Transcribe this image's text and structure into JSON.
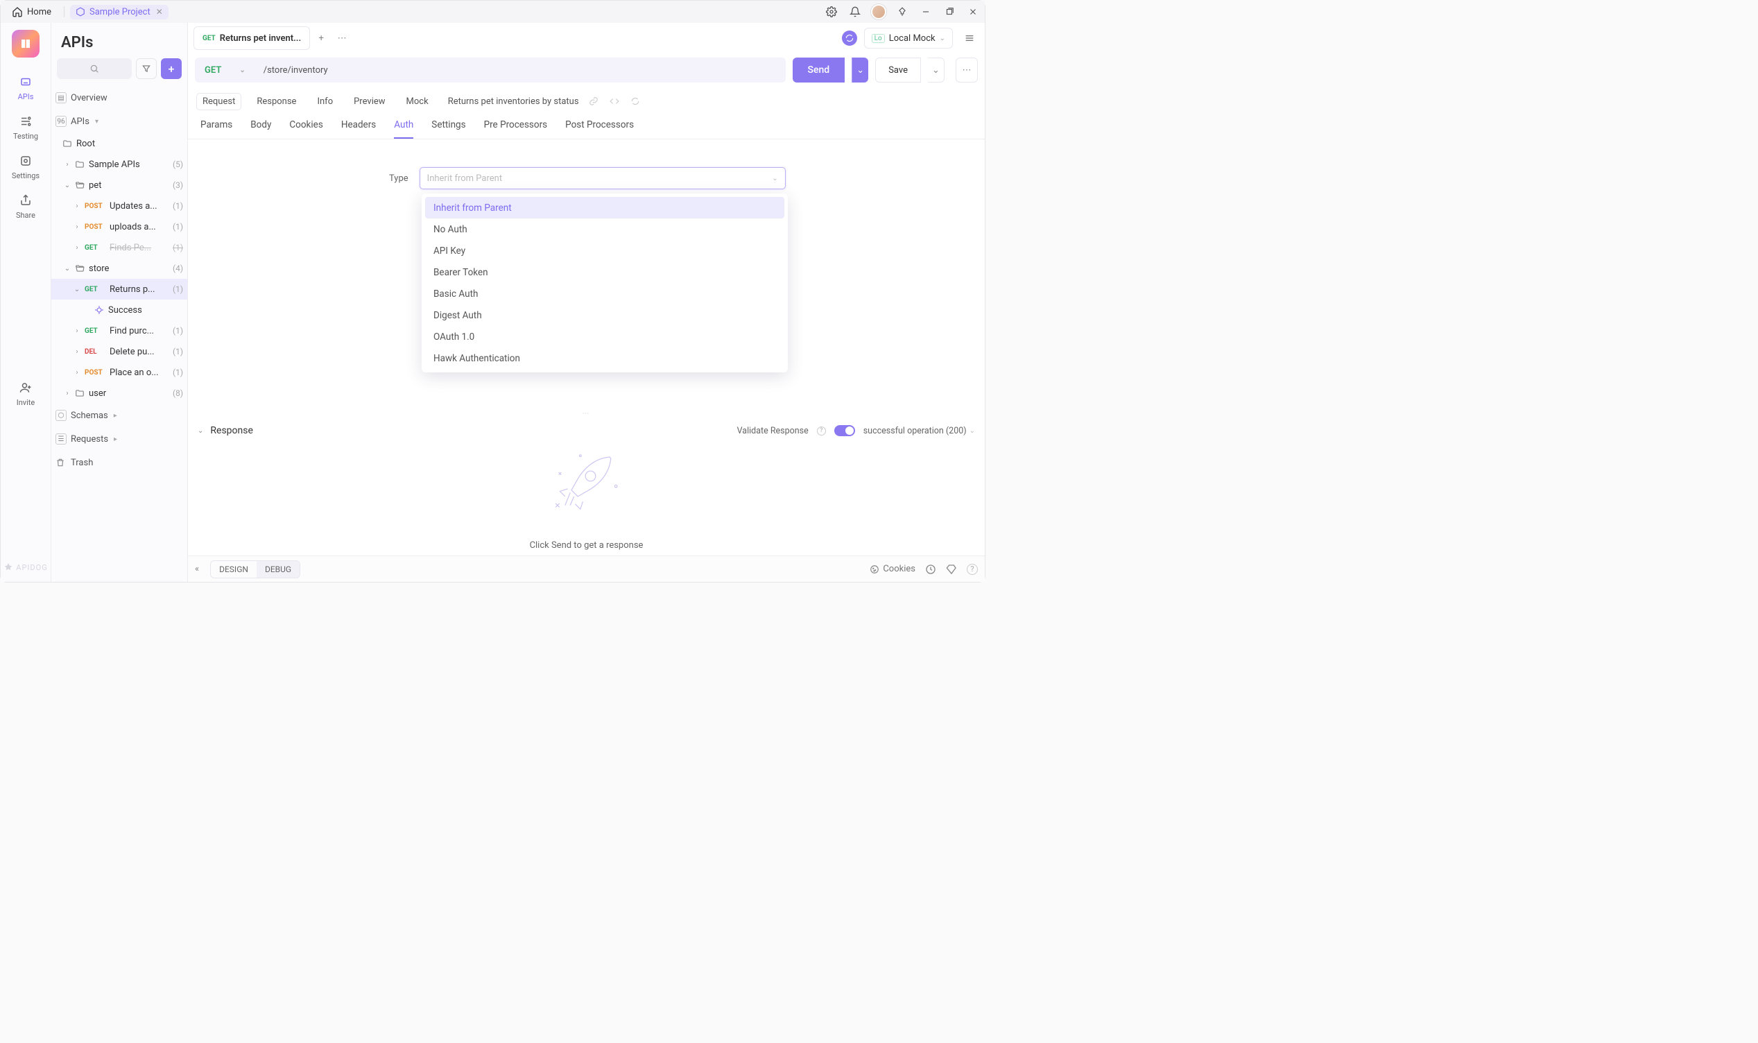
{
  "titlebar": {
    "home": "Home",
    "project": "Sample Project"
  },
  "rail": {
    "items": [
      "APIs",
      "Testing",
      "Settings",
      "Share",
      "Invite"
    ],
    "brand": "APIDOG"
  },
  "sidebar": {
    "title": "APIs",
    "overview": "Overview",
    "apis_label": "APIs",
    "root": "Root",
    "sample_apis": {
      "label": "Sample APIs",
      "count": "(5)"
    },
    "pet": {
      "label": "pet",
      "count": "(3)"
    },
    "pet_children": [
      {
        "method": "POST",
        "label": "Updates a...",
        "count": "(1)"
      },
      {
        "method": "POST",
        "label": "uploads a...",
        "count": "(1)"
      },
      {
        "method": "GET",
        "label": "Finds Pe...",
        "count": "(1)",
        "deprecated": true
      }
    ],
    "store": {
      "label": "store",
      "count": "(4)"
    },
    "store_children": [
      {
        "method": "GET",
        "label": "Returns p...",
        "count": "(1)",
        "selected": true
      },
      {
        "sub": true,
        "label": "Success"
      },
      {
        "method": "GET",
        "label": "Find purc...",
        "count": "(1)"
      },
      {
        "method": "DEL",
        "label": "Delete pu...",
        "count": "(1)"
      },
      {
        "method": "POST",
        "label": "Place an o...",
        "count": "(1)"
      }
    ],
    "user": {
      "label": "user",
      "count": "(8)"
    },
    "schemas": "Schemas",
    "requests": "Requests",
    "trash": "Trash"
  },
  "doc_tab": {
    "method": "GET",
    "title": "Returns pet invent..."
  },
  "env": {
    "label": "Local Mock"
  },
  "request_line": {
    "method": "GET",
    "url": "/store/inventory",
    "send": "Send",
    "save": "Save"
  },
  "row_tabs": [
    "Request",
    "Response",
    "Info",
    "Preview",
    "Mock"
  ],
  "row_tabs_title": "Returns pet inventories by status",
  "sub_tabs": [
    "Params",
    "Body",
    "Cookies",
    "Headers",
    "Auth",
    "Settings",
    "Pre Processors",
    "Post Processors"
  ],
  "auth": {
    "type_label": "Type",
    "placeholder": "Inherit from Parent",
    "options": [
      "Inherit from Parent",
      "No Auth",
      "API Key",
      "Bearer Token",
      "Basic Auth",
      "Digest Auth",
      "OAuth 1.0",
      "Hawk Authentication"
    ]
  },
  "response": {
    "label": "Response",
    "validate": "Validate Response",
    "status": "successful operation (200)",
    "empty": "Click Send to get a response"
  },
  "footer": {
    "design": "DESIGN",
    "debug": "DEBUG",
    "cookies": "Cookies"
  }
}
